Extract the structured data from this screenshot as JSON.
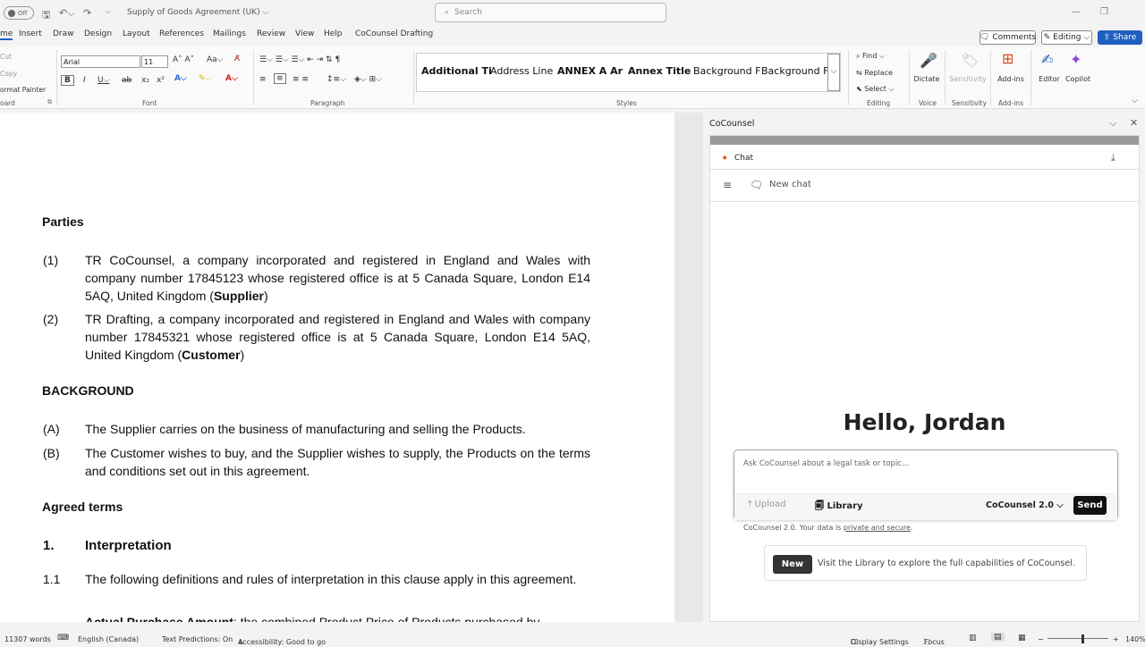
{
  "titlebar": {
    "autosave": "Off",
    "doc_title": "Supply of Goods Agreement (UK) ⌵",
    "search_placeholder": "Search"
  },
  "tabs": [
    "me",
    "Insert",
    "Draw",
    "Design",
    "Layout",
    "References",
    "Mailings",
    "Review",
    "View",
    "Help",
    "CoCounsel Drafting"
  ],
  "top_right": {
    "comments": "Comments",
    "editing": "Editing",
    "share": "Share"
  },
  "ribbon": {
    "clipboard": {
      "cut": "Cut",
      "copy": "Copy",
      "format_painter": "ormat Painter",
      "label": "oard"
    },
    "font": {
      "name": "Arial",
      "size": "11",
      "label": "Font"
    },
    "paragraph": {
      "label": "Paragraph"
    },
    "styles": {
      "items": [
        "Additional Ti",
        "Address Line",
        "ANNEX A Ar",
        "Annex Title",
        "Background F",
        "Background F"
      ],
      "label": "Styles"
    },
    "editing": {
      "find": "Find",
      "replace": "Replace",
      "select": "Select",
      "label": "Editing"
    },
    "voice": {
      "dictate": "Dictate",
      "label": "Voice"
    },
    "sensitivity": {
      "btn": "Sensitivity",
      "label": "Sensitivity"
    },
    "addins": {
      "btn": "Add-ins",
      "label": "Add-ins"
    },
    "editor": "Editor",
    "copilot": "Copilot"
  },
  "document": {
    "parties_heading": "Parties",
    "party1": {
      "num": "(1)",
      "text_a": "TR CoCounsel, a company incorporated and registered in England and Wales with company number 17845123 whose registered office is at 5 Canada Square, London E14 5AQ, United Kingdom (",
      "bold": "Supplier",
      "text_b": ")"
    },
    "party2": {
      "num": "(2)",
      "text_a": "TR Drafting, a company incorporated and registered in England and Wales with company number 17845321 whose registered office is at 5 Canada Square, London E14 5AQ, United Kingdom (",
      "bold": "Customer",
      "text_b": ")"
    },
    "background_heading": "BACKGROUND",
    "bgA": {
      "num": "(A)",
      "text": "The Supplier carries on the business of manufacturing and selling the Products."
    },
    "bgB": {
      "num": "(B)",
      "text": "The Customer wishes to buy, and the Supplier wishes to supply, the Products on the terms and conditions set out in this agreement."
    },
    "agreed_heading": "Agreed terms",
    "interp_num": "1.",
    "interp_heading": "Interpretation",
    "c11": {
      "num": "1.1",
      "text": "The following definitions and rules of interpretation in this clause apply in this agreement."
    },
    "clip_bold": "Actual Purchase Amount",
    "clip_text": ": the combined Product Price of Products purchased by"
  },
  "panel": {
    "title": "CoCounsel",
    "chat_label": "Chat",
    "new_chat": "New chat",
    "greeting": "Hello, Jordan",
    "input_placeholder": "Ask CoCounsel about a legal task or topic...",
    "upload": "Upload",
    "library": "Library",
    "model": "CoCounsel 2.0",
    "send": "Send",
    "footnote_a": "CoCounsel 2.0. Your data is ",
    "footnote_link": "private and secure",
    "footnote_b": ".",
    "new_badge": "New",
    "promo": "Visit the Library to explore the full capabilities of CoCounsel."
  },
  "status": {
    "words": "11307 words",
    "language": "English (Canada)",
    "predictions": "Text Predictions: On",
    "accessibility": "Accessibility: Good to go",
    "display": "Display Settings",
    "focus": "Focus",
    "zoom": "140%"
  }
}
